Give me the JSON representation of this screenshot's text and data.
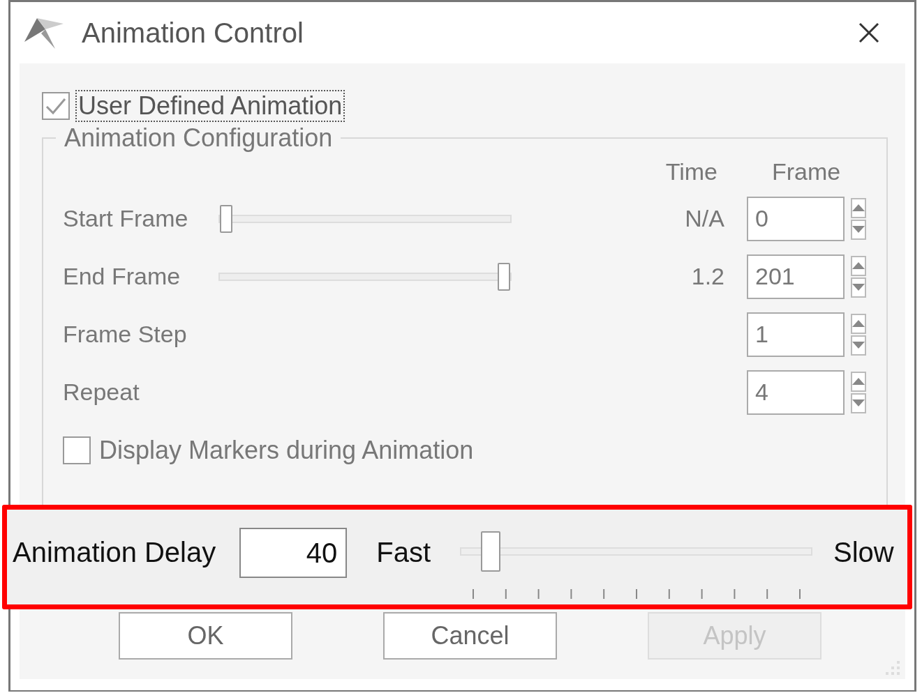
{
  "window": {
    "title": "Animation Control"
  },
  "user_defined": {
    "label": "User Defined Animation",
    "checked": true,
    "focused": true
  },
  "configuration": {
    "title": "Animation Configuration",
    "disabled": true,
    "columns": [
      "Time",
      "Frame"
    ],
    "rows": [
      {
        "kind": "slider",
        "label": "Start Frame",
        "level": 0,
        "time": "N/A",
        "value": "0"
      },
      {
        "kind": "slider",
        "label": "End Frame",
        "level": 1,
        "time": "1.2",
        "value": "201"
      },
      {
        "kind": "spin",
        "label": "Frame Step",
        "value": "1"
      },
      {
        "kind": "spin",
        "label": "Repeat",
        "value": "4"
      }
    ],
    "display_markers": {
      "label": "Display Markers during Animation",
      "checked": false
    }
  },
  "delay": {
    "label": "Animation Delay",
    "value": "40",
    "min_label": "Fast",
    "max_label": "Slow",
    "level": 0.06,
    "highlighted": true
  },
  "buttons": [
    {
      "label": "OK",
      "disabled": false
    },
    {
      "label": "Cancel",
      "disabled": false
    },
    {
      "label": "Apply",
      "disabled": true
    }
  ]
}
